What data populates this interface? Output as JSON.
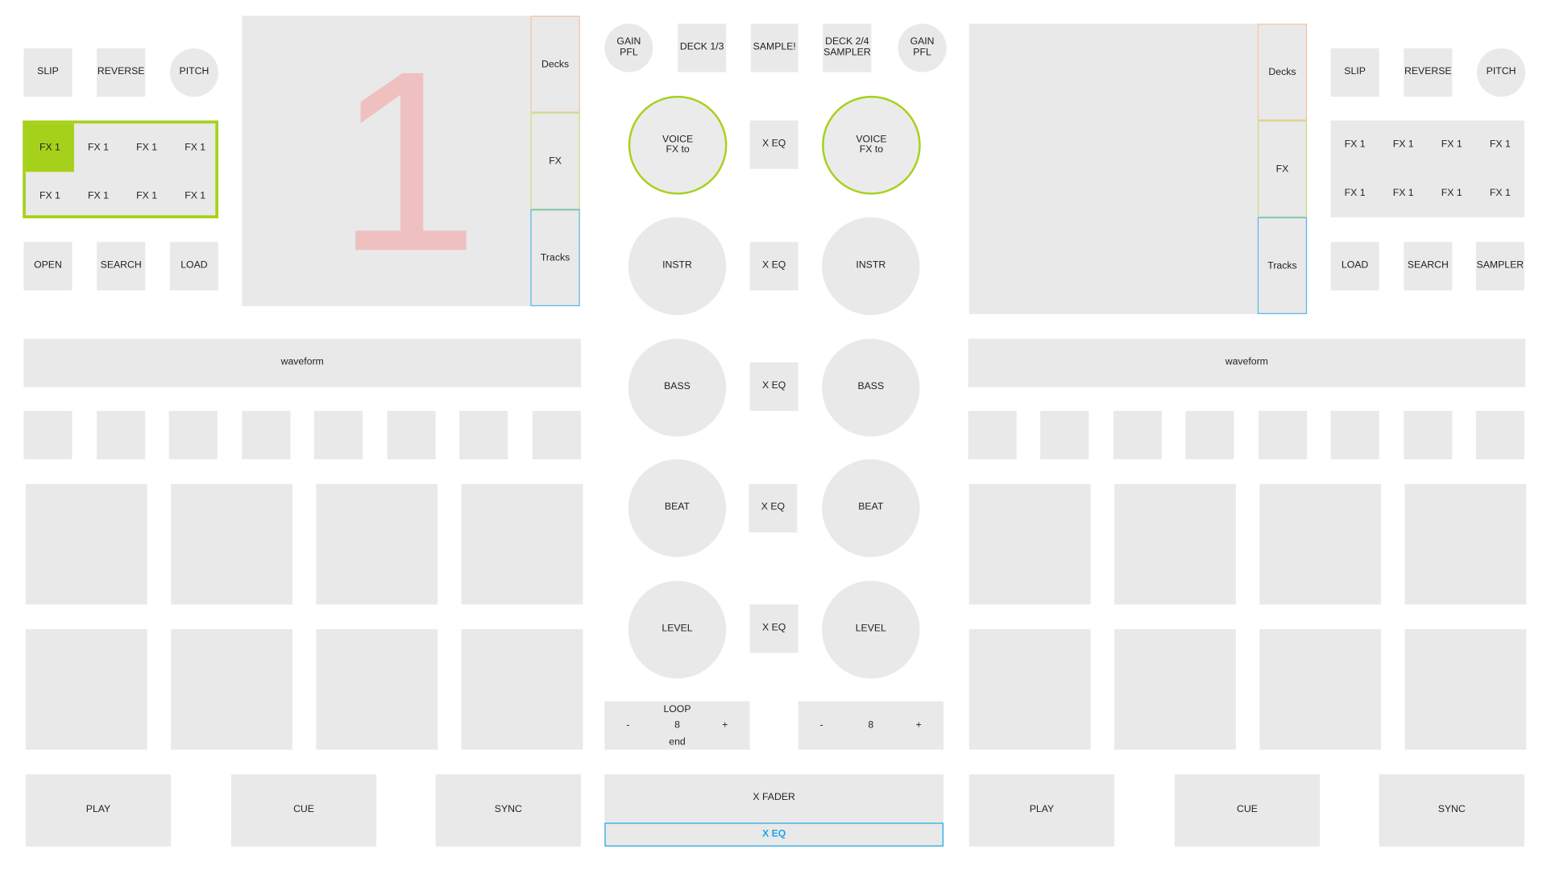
{
  "left_deck": {
    "slip": "SLIP",
    "reverse": "REVERSE",
    "pitch": "PITCH",
    "fx_cells": [
      "FX 1",
      "FX 1",
      "FX 1",
      "FX 1",
      "FX 1",
      "FX 1",
      "FX 1",
      "FX 1"
    ],
    "fx_active_index": 0,
    "open": "OPEN",
    "search": "SEARCH",
    "load": "LOAD",
    "deck_number": "1",
    "tabs": {
      "decks": "Decks",
      "fx": "FX",
      "tracks": "Tracks"
    },
    "waveform": "waveform",
    "play": "PLAY",
    "cue": "CUE",
    "sync": "SYNC"
  },
  "right_deck": {
    "slip": "SLIP",
    "reverse": "REVERSE",
    "pitch": "PITCH",
    "fx_cells": [
      "FX 1",
      "FX 1",
      "FX 1",
      "FX 1",
      "FX 1",
      "FX 1",
      "FX 1",
      "FX 1"
    ],
    "load": "LOAD",
    "search": "SEARCH",
    "sampler": "SAMPLER",
    "tabs": {
      "decks": "Decks",
      "fx": "FX",
      "tracks": "Tracks"
    },
    "waveform": "waveform",
    "play": "PLAY",
    "cue": "CUE",
    "sync": "SYNC"
  },
  "mixer": {
    "gain_pfl_left": "GAIN\nPFL",
    "deck_13": "DECK 1/3",
    "sample": "SAMPLE!",
    "deck_24_sampler": "DECK 2/4\nSAMPLER",
    "gain_pfl_right": "GAIN\nPFL",
    "voice_left": "VOICE\nFX to",
    "voice_right": "VOICE\nFX to",
    "instr": "INSTR",
    "bass": "BASS",
    "beat": "BEAT",
    "level": "LEVEL",
    "x_eq": "X EQ",
    "loop": {
      "title": "LOOP",
      "minus": "-",
      "value": "8",
      "plus": "+",
      "end": "end"
    },
    "loop_right": {
      "minus": "-",
      "value": "8",
      "plus": "+"
    },
    "x_fader": "X FADER",
    "x_eq_bottom": "X EQ"
  },
  "colors": {
    "pad": "#e9e9e9",
    "accent_green": "#a6d11a",
    "decks_tab": "#f5c1a3",
    "fx_tab": "#c5e07a",
    "tracks_tab": "#5ab6e6",
    "deck_number": "#efc0c0",
    "x_eq_text": "#1da6e6"
  }
}
